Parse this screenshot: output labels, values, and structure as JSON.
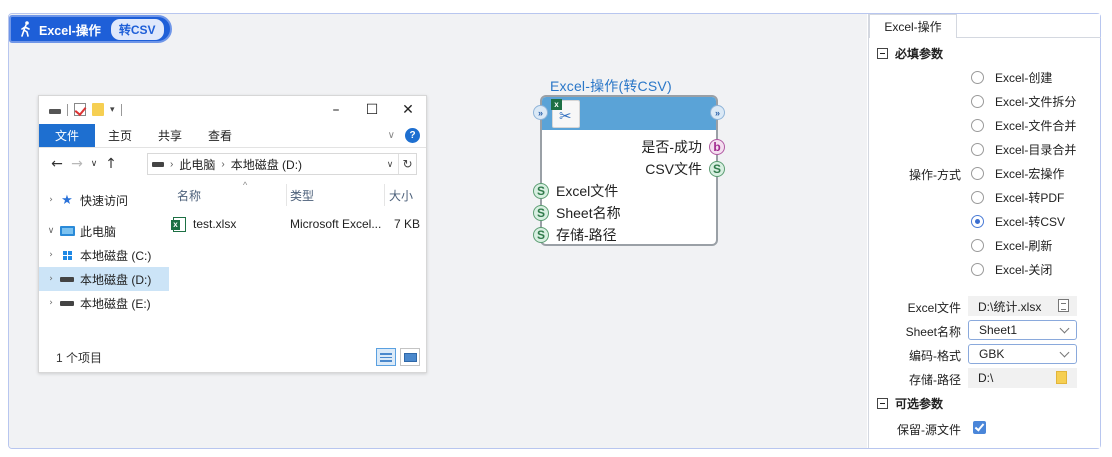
{
  "workflow": {
    "title": "Excel-操作",
    "badge": "转CSV"
  },
  "explorer": {
    "window_controls": {
      "minimize": "–",
      "maximize": "☐",
      "close": "✕"
    },
    "ribbon_tabs": [
      "文件",
      "主页",
      "共享",
      "查看"
    ],
    "address_path": [
      "此电脑",
      "本地磁盘 (D:)"
    ],
    "tree": [
      {
        "label": "快速访问",
        "icon": "star-icon",
        "expanded": false
      },
      {
        "label": "此电脑",
        "icon": "computer-icon",
        "expanded": true
      },
      {
        "label": "本地磁盘 (C:)",
        "icon": "windows-drive-icon",
        "expanded": false
      },
      {
        "label": "本地磁盘 (D:)",
        "icon": "drive-icon",
        "expanded": false,
        "selected": true
      },
      {
        "label": "本地磁盘 (E:)",
        "icon": "drive-icon",
        "expanded": false
      }
    ],
    "columns": [
      "名称",
      "类型",
      "大小"
    ],
    "files": [
      {
        "name": "test.xlsx",
        "type": "Microsoft Excel...",
        "size": "7 KB"
      }
    ],
    "status": "1 个项目"
  },
  "node": {
    "title": "Excel-操作(转CSV)",
    "outputs": [
      {
        "label": "是否-成功",
        "port": "b"
      },
      {
        "label": "CSV文件",
        "port": "S"
      }
    ],
    "inputs": [
      {
        "label": "Excel文件",
        "port": "S"
      },
      {
        "label": "Sheet名称",
        "port": "S"
      },
      {
        "label": "存储-路径",
        "port": "S"
      }
    ]
  },
  "panel": {
    "tab": "Excel-操作",
    "required_section": "必填参数",
    "operation_label": "操作-方式",
    "operations": [
      "Excel-创建",
      "Excel-文件拆分",
      "Excel-文件合并",
      "Excel-目录合并",
      "Excel-宏操作",
      "Excel-转PDF",
      "Excel-转CSV",
      "Excel-刷新",
      "Excel-关闭"
    ],
    "selected_operation": "Excel-转CSV",
    "excel_file": {
      "label": "Excel文件",
      "value": "D:\\统计.xlsx"
    },
    "sheet_name": {
      "label": "Sheet名称",
      "value": "Sheet1"
    },
    "encoding": {
      "label": "编码-格式",
      "value": "GBK"
    },
    "save_path": {
      "label": "存储-路径",
      "value": "D:\\"
    },
    "optional_section": "可选参数",
    "keep_source": {
      "label": "保留-源文件",
      "checked": true
    }
  },
  "colors": {
    "accent": "#1e5fd8",
    "node_header": "#5aa3d7",
    "excel_green": "#1d7044"
  }
}
